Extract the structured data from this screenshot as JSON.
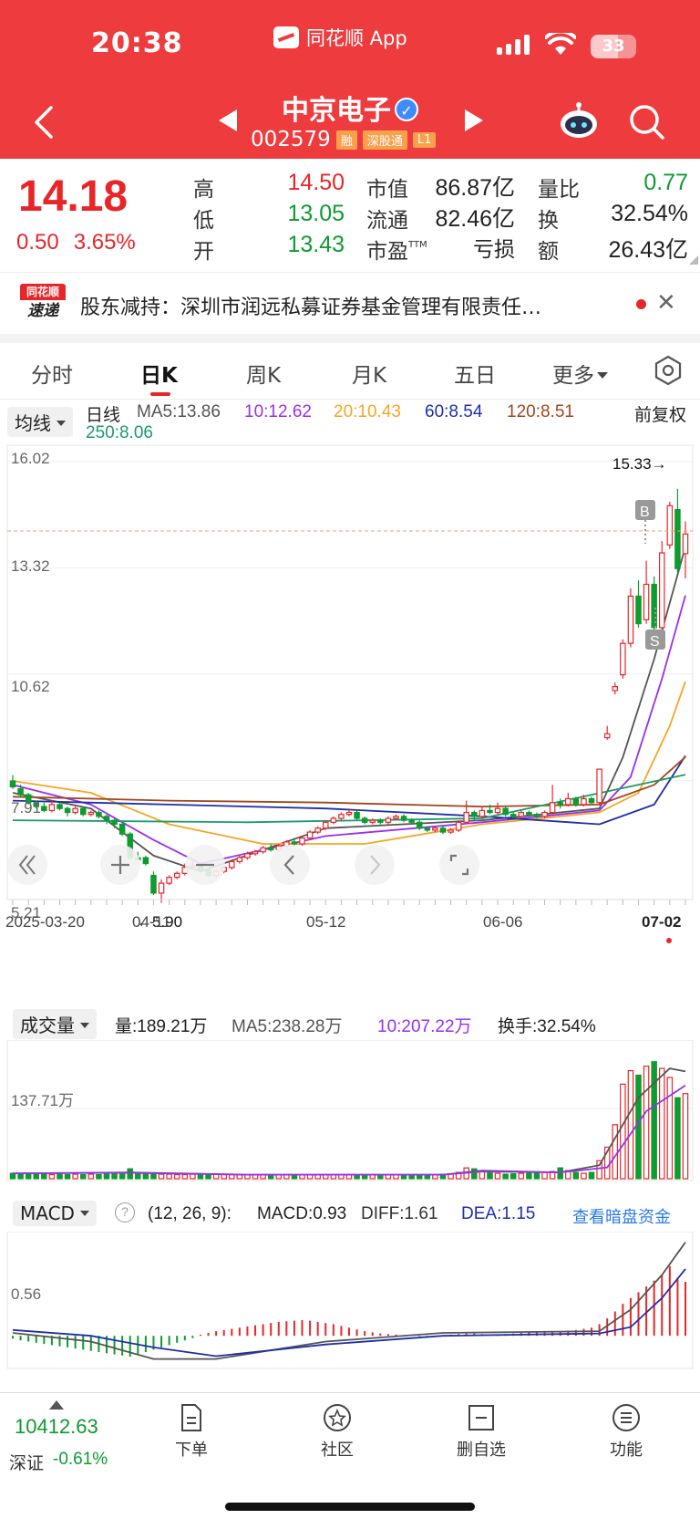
{
  "status_bar": {
    "time": "20:38",
    "app_name": "同花顺 App",
    "battery": "33"
  },
  "stock": {
    "name": "中京电子",
    "code": "002579",
    "tags": [
      "融",
      "深股通",
      "L1"
    ]
  },
  "quote": {
    "price": "14.18",
    "change": "0.50",
    "change_pct": "3.65%",
    "high_label": "高",
    "high": "14.50",
    "low_label": "低",
    "low": "13.05",
    "open_label": "开",
    "open": "13.43",
    "mcap_label": "市值",
    "mcap": "86.87亿",
    "float_label": "流通",
    "float_cap": "82.46亿",
    "pe_label": "市盈",
    "pe_sup": "TTM",
    "pe": "亏损",
    "vr_label": "量比",
    "vr": "0.77",
    "turnover_label": "换",
    "turnover": "32.54%",
    "amount_label": "额",
    "amount": "26.43亿"
  },
  "news": {
    "logo_top": "同花顺",
    "logo_bottom": "速递",
    "text": "股东减持：深圳市润远私募证券基金管理有限责任…"
  },
  "tabs": [
    {
      "label": "分时"
    },
    {
      "label": "日K"
    },
    {
      "label": "周K"
    },
    {
      "label": "月K"
    },
    {
      "label": "五日"
    },
    {
      "label": "更多"
    }
  ],
  "ma_legend": {
    "selector": "均线",
    "period": "日线",
    "ma5": "MA5:13.86",
    "ma10": "10:12.62",
    "ma20": "20:10.43",
    "ma60": "60:8.54",
    "ma120": "120:8.51",
    "ma250": "250:8.06",
    "adjust": "前复权"
  },
  "colors": {
    "header": "#ee3b3e",
    "up": "#e8262a",
    "down": "#0e9b2f",
    "ma5": "#555555",
    "ma10": "#9a2ff0",
    "ma20": "#f5a623",
    "ma60": "#1f2fa8",
    "ma120": "#a0461f",
    "ma250": "#1d9b6b"
  },
  "kchart_labels": {
    "y_ticks": [
      "16.02",
      "13.32",
      "10.62",
      "7.91",
      "5.21"
    ],
    "x_ticks": [
      "2025-03-20",
      "04-11",
      "05-12",
      "06-06",
      "07-02"
    ],
    "high_mark": "15.33→",
    "low_mark": "←5.90",
    "buy": "B",
    "sell": "S"
  },
  "chart_data": [
    {
      "type": "candlestick",
      "title": "日线",
      "ylim": [
        5.21,
        16.02
      ],
      "x_range": [
        "2025-03-20",
        "07-02"
      ],
      "candles": [
        [
          7.9,
          7.75,
          8.05,
          7.7
        ],
        [
          7.7,
          7.55,
          7.8,
          7.5
        ],
        [
          7.55,
          7.35,
          7.6,
          7.3
        ],
        [
          7.35,
          7.25,
          7.4,
          7.2
        ],
        [
          7.25,
          7.15,
          7.35,
          7.1
        ],
        [
          7.15,
          7.3,
          7.4,
          7.1
        ],
        [
          7.3,
          7.2,
          7.35,
          7.15
        ],
        [
          7.2,
          7.1,
          7.25,
          7.0
        ],
        [
          7.1,
          7.2,
          7.25,
          7.05
        ],
        [
          7.2,
          7.05,
          7.25,
          7.0
        ],
        [
          7.05,
          7.1,
          7.15,
          7.0
        ],
        [
          7.1,
          7.0,
          7.15,
          6.95
        ],
        [
          7.0,
          6.9,
          7.05,
          6.8
        ],
        [
          6.9,
          6.8,
          6.95,
          6.7
        ],
        [
          6.8,
          6.55,
          6.85,
          6.5
        ],
        [
          6.55,
          5.95,
          6.6,
          5.9
        ],
        [
          5.95,
          5.9,
          6.1,
          5.9
        ],
        [
          5.95,
          5.8,
          6.0,
          5.75
        ],
        [
          5.5,
          5.05,
          5.6,
          5.0
        ],
        [
          5.05,
          5.3,
          5.4,
          4.8
        ],
        [
          5.3,
          5.45,
          5.5,
          5.25
        ],
        [
          5.45,
          5.55,
          5.6,
          5.4
        ],
        [
          5.55,
          5.7,
          5.8,
          5.5
        ],
        [
          5.7,
          5.75,
          5.85,
          5.65
        ],
        [
          5.75,
          5.65,
          5.8,
          5.55
        ],
        [
          5.65,
          5.5,
          5.7,
          5.45
        ],
        [
          5.5,
          5.6,
          5.65,
          5.45
        ],
        [
          5.6,
          5.7,
          5.75,
          5.55
        ],
        [
          5.7,
          5.85,
          5.9,
          5.65
        ],
        [
          5.85,
          5.95,
          6.0,
          5.8
        ],
        [
          5.95,
          6.05,
          6.1,
          5.9
        ],
        [
          6.05,
          6.1,
          6.15,
          6.0
        ],
        [
          6.1,
          6.2,
          6.25,
          6.05
        ],
        [
          6.2,
          6.15,
          6.3,
          6.1
        ],
        [
          6.15,
          6.25,
          6.3,
          6.1
        ],
        [
          6.25,
          6.35,
          6.4,
          6.2
        ],
        [
          6.35,
          6.3,
          6.45,
          6.25
        ],
        [
          6.3,
          6.45,
          6.5,
          6.25
        ],
        [
          6.45,
          6.6,
          6.65,
          6.4
        ],
        [
          6.6,
          6.7,
          6.75,
          6.55
        ],
        [
          6.7,
          6.85,
          6.9,
          6.65
        ],
        [
          6.85,
          6.95,
          7.0,
          6.8
        ],
        [
          6.95,
          7.05,
          7.1,
          6.9
        ],
        [
          7.05,
          7.1,
          7.2,
          7.0
        ],
        [
          7.1,
          6.95,
          7.15,
          6.9
        ],
        [
          6.95,
          6.85,
          7.0,
          6.8
        ],
        [
          6.85,
          6.9,
          6.95,
          6.8
        ],
        [
          6.9,
          6.85,
          6.95,
          6.8
        ],
        [
          6.85,
          6.95,
          7.0,
          6.8
        ],
        [
          6.95,
          7.0,
          7.05,
          6.9
        ],
        [
          7.0,
          6.9,
          7.05,
          6.85
        ],
        [
          6.9,
          6.85,
          6.95,
          6.8
        ],
        [
          6.85,
          6.7,
          6.9,
          6.65
        ],
        [
          6.7,
          6.65,
          6.75,
          6.6
        ],
        [
          6.65,
          6.7,
          6.75,
          6.6
        ],
        [
          6.7,
          6.6,
          6.75,
          6.55
        ],
        [
          6.6,
          6.65,
          6.7,
          6.55
        ],
        [
          6.65,
          6.85,
          6.9,
          6.6
        ],
        [
          6.85,
          7.1,
          7.4,
          6.8
        ],
        [
          7.1,
          7.0,
          7.15,
          6.9
        ],
        [
          7.0,
          7.15,
          7.25,
          6.95
        ],
        [
          7.15,
          7.1,
          7.3,
          7.05
        ],
        [
          7.1,
          7.2,
          7.35,
          7.05
        ],
        [
          7.2,
          7.05,
          7.25,
          7.0
        ],
        [
          7.05,
          7.0,
          7.1,
          6.95
        ],
        [
          7.0,
          7.1,
          7.15,
          6.95
        ],
        [
          7.1,
          7.05,
          7.15,
          7.0
        ],
        [
          7.05,
          7.0,
          7.1,
          6.95
        ],
        [
          7.0,
          7.1,
          7.15,
          6.95
        ],
        [
          7.1,
          7.35,
          7.8,
          7.05
        ],
        [
          7.35,
          7.3,
          7.45,
          7.2
        ],
        [
          7.3,
          7.45,
          7.6,
          7.25
        ],
        [
          7.45,
          7.3,
          7.5,
          7.25
        ],
        [
          7.3,
          7.45,
          7.55,
          7.25
        ],
        [
          7.45,
          7.35,
          7.5,
          7.3
        ],
        [
          7.35,
          8.2,
          8.2,
          7.3
        ],
        [
          9.0,
          9.1,
          9.3,
          8.95
        ],
        [
          10.2,
          10.3,
          10.4,
          10.1
        ],
        [
          10.6,
          11.4,
          11.5,
          10.5
        ],
        [
          11.4,
          12.6,
          12.8,
          11.3
        ],
        [
          12.6,
          11.9,
          13.0,
          11.8
        ],
        [
          12.0,
          12.9,
          13.5,
          11.9
        ],
        [
          12.9,
          11.8,
          13.1,
          11.7
        ],
        [
          11.8,
          13.7,
          14.0,
          11.6
        ],
        [
          13.9,
          14.9,
          15.0,
          13.8
        ],
        [
          14.8,
          13.3,
          15.33,
          13.2
        ],
        [
          13.68,
          14.18,
          14.5,
          13.05
        ]
      ],
      "ma_series": {
        "ma5": [
          [
            0,
            7.6
          ],
          [
            10,
            7.2
          ],
          [
            18,
            6.0
          ],
          [
            24,
            5.6
          ],
          [
            40,
            6.7
          ],
          [
            60,
            6.9
          ],
          [
            75,
            7.2
          ],
          [
            78,
            8.5
          ],
          [
            82,
            11.0
          ],
          [
            86,
            13.86
          ]
        ],
        "ma10": [
          [
            0,
            7.8
          ],
          [
            10,
            7.3
          ],
          [
            18,
            6.4
          ],
          [
            24,
            5.8
          ],
          [
            40,
            6.5
          ],
          [
            60,
            6.85
          ],
          [
            75,
            7.15
          ],
          [
            79,
            8.0
          ],
          [
            83,
            10.5
          ],
          [
            86,
            12.62
          ]
        ],
        "ma20": [
          [
            0,
            7.9
          ],
          [
            10,
            7.6
          ],
          [
            20,
            6.8
          ],
          [
            32,
            6.3
          ],
          [
            45,
            6.3
          ],
          [
            60,
            6.8
          ],
          [
            75,
            7.1
          ],
          [
            80,
            7.6
          ],
          [
            84,
            9.3
          ],
          [
            86,
            10.43
          ]
        ],
        "ma60": [
          [
            0,
            7.4
          ],
          [
            20,
            7.3
          ],
          [
            40,
            7.2
          ],
          [
            60,
            7.0
          ],
          [
            75,
            6.8
          ],
          [
            82,
            7.3
          ],
          [
            86,
            8.54
          ]
        ],
        "ma120": [
          [
            0,
            7.5
          ],
          [
            20,
            7.4
          ],
          [
            40,
            7.35
          ],
          [
            60,
            7.25
          ],
          [
            75,
            7.3
          ],
          [
            82,
            7.8
          ],
          [
            86,
            8.51
          ]
        ],
        "ma250": [
          [
            0,
            6.9
          ],
          [
            30,
            6.85
          ],
          [
            60,
            6.95
          ],
          [
            86,
            8.06
          ]
        ]
      }
    },
    {
      "type": "bar",
      "title": "成交量",
      "unit": "万",
      "y_tick": "137.71万",
      "ylim": [
        0,
        300
      ],
      "values": [
        12,
        10,
        11,
        9,
        10,
        9,
        10,
        9,
        10,
        9,
        10,
        9,
        10,
        11,
        14,
        22,
        12,
        12,
        11,
        10,
        10,
        9,
        9,
        10,
        9,
        9,
        10,
        9,
        9,
        9,
        9,
        9,
        9,
        9,
        9,
        9,
        9,
        9,
        9,
        9,
        9,
        9,
        9,
        9,
        9,
        9,
        9,
        9,
        9,
        9,
        9,
        9,
        9,
        9,
        9,
        10,
        11,
        14,
        24,
        22,
        18,
        14,
        12,
        10,
        11,
        12,
        12,
        14,
        14,
        16,
        24,
        18,
        14,
        12,
        14,
        40,
        70,
        120,
        210,
        240,
        230,
        250,
        260,
        245,
        225,
        180,
        189.21
      ],
      "ma5": [
        [
          0,
          12
        ],
        [
          15,
          14
        ],
        [
          30,
          9
        ],
        [
          55,
          9
        ],
        [
          60,
          18
        ],
        [
          70,
          14
        ],
        [
          75,
          30
        ],
        [
          80,
          180
        ],
        [
          84,
          245
        ],
        [
          86,
          238.28
        ]
      ],
      "ma10": [
        [
          0,
          12
        ],
        [
          15,
          13
        ],
        [
          30,
          9
        ],
        [
          55,
          9
        ],
        [
          60,
          16
        ],
        [
          70,
          14
        ],
        [
          76,
          25
        ],
        [
          81,
          150
        ],
        [
          86,
          207.22
        ]
      ]
    },
    {
      "type": "macd",
      "title": "MACD",
      "params": "(12, 26, 9)",
      "y_tick": "0.56",
      "ylim": [
        -0.5,
        1.7
      ],
      "hist": [
        -0.05,
        -0.08,
        -0.1,
        -0.12,
        -0.14,
        -0.16,
        -0.18,
        -0.2,
        -0.22,
        -0.24,
        -0.26,
        -0.28,
        -0.3,
        -0.32,
        -0.34,
        -0.36,
        -0.32,
        -0.28,
        -0.24,
        -0.2,
        -0.16,
        -0.12,
        -0.08,
        -0.04,
        0.02,
        0.05,
        0.08,
        0.1,
        0.12,
        0.14,
        0.16,
        0.18,
        0.2,
        0.22,
        0.24,
        0.25,
        0.26,
        0.27,
        0.26,
        0.24,
        0.22,
        0.2,
        0.17,
        0.14,
        0.11,
        0.08,
        0.06,
        0.04,
        0.03,
        0.02,
        0.01,
        0.0,
        -0.01,
        -0.02,
        0.0,
        0.01,
        0.02,
        0.03,
        0.04,
        0.04,
        0.03,
        0.02,
        0.02,
        0.03,
        0.04,
        0.05,
        0.06,
        0.06,
        0.07,
        0.08,
        0.08,
        0.09,
        0.1,
        0.12,
        0.14,
        0.2,
        0.3,
        0.42,
        0.55,
        0.65,
        0.75,
        0.85,
        0.95,
        1.05,
        1.2,
        1.0,
        0.93
      ],
      "diff": [
        [
          0,
          0.05
        ],
        [
          10,
          -0.1
        ],
        [
          18,
          -0.4
        ],
        [
          26,
          -0.4
        ],
        [
          40,
          -0.1
        ],
        [
          55,
          0.05
        ],
        [
          75,
          0.08
        ],
        [
          79,
          0.45
        ],
        [
          83,
          1.05
        ],
        [
          86,
          1.61
        ]
      ],
      "dea": [
        [
          0,
          0.1
        ],
        [
          10,
          0.0
        ],
        [
          18,
          -0.2
        ],
        [
          26,
          -0.35
        ],
        [
          40,
          -0.15
        ],
        [
          55,
          0.0
        ],
        [
          75,
          0.04
        ],
        [
          79,
          0.15
        ],
        [
          83,
          0.65
        ],
        [
          86,
          1.15
        ]
      ]
    }
  ],
  "volume_header": {
    "selector": "成交量",
    "vol": "量:189.21万",
    "ma5": "MA5:238.28万",
    "ma10": "10:207.22万",
    "turnover": "换手:32.54%"
  },
  "macd_header": {
    "selector": "MACD",
    "help": "?",
    "params": "(12, 26, 9):",
    "macd": "MACD:0.93",
    "diff": "DIFF:1.61",
    "dea": "DEA:1.15",
    "dark_pool": "查看暗盘资金"
  },
  "bottom": {
    "index_value": "10412.63",
    "index_name": "深证",
    "index_change": "-0.61%",
    "nav": [
      "下单",
      "社区",
      "删自选",
      "功能"
    ]
  }
}
